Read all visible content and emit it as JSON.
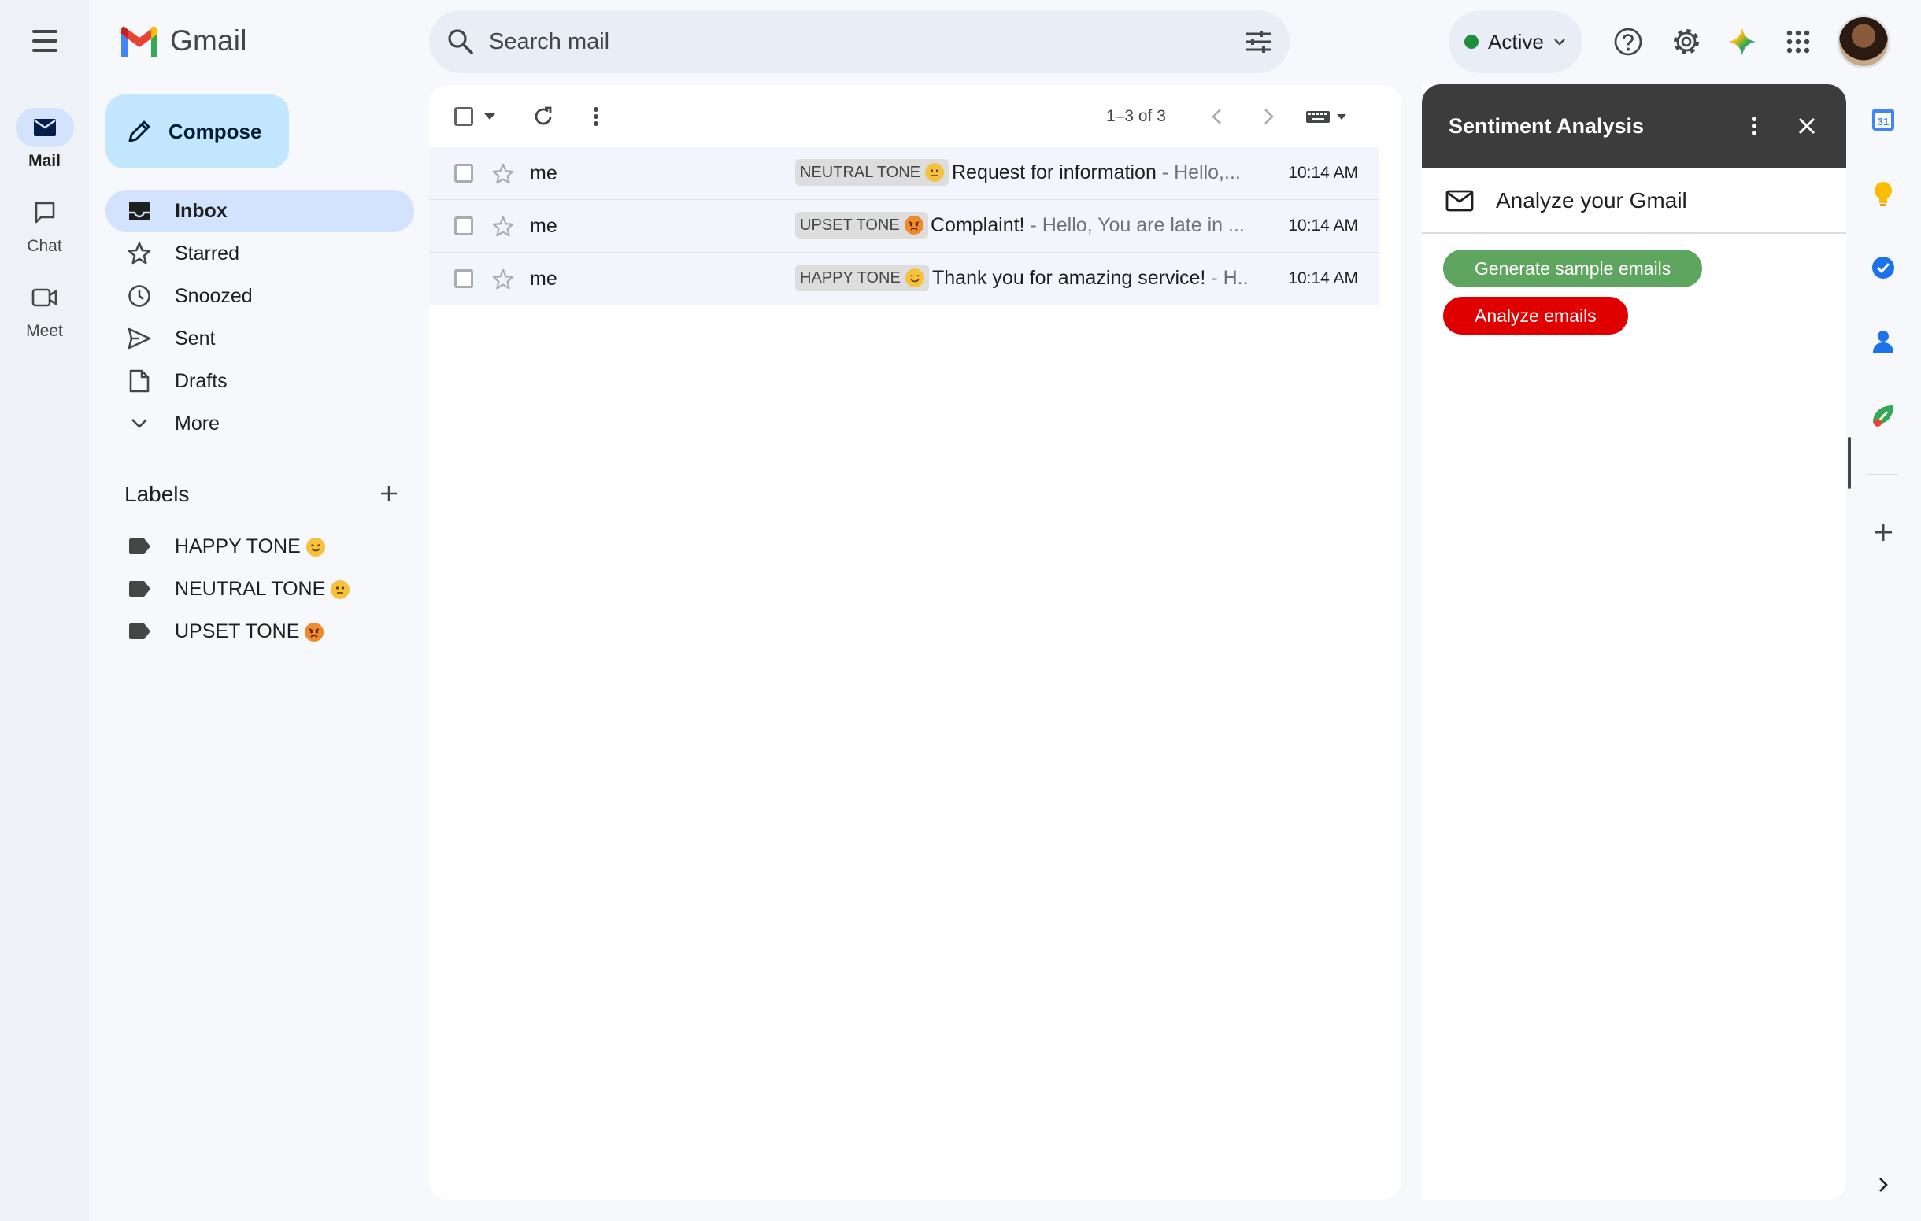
{
  "app": {
    "logo_text": "Gmail"
  },
  "rail": {
    "items": [
      {
        "label": "Mail",
        "icon": "mail-icon"
      },
      {
        "label": "Chat",
        "icon": "chat-icon"
      },
      {
        "label": "Meet",
        "icon": "video-icon"
      }
    ]
  },
  "search": {
    "placeholder": "Search mail"
  },
  "status": {
    "label": "Active",
    "color": "#1e8e3e"
  },
  "compose": {
    "label": "Compose"
  },
  "nav": {
    "items": [
      {
        "label": "Inbox",
        "icon": "inbox-icon"
      },
      {
        "label": "Starred",
        "icon": "star-icon"
      },
      {
        "label": "Snoozed",
        "icon": "clock-icon"
      },
      {
        "label": "Sent",
        "icon": "send-icon"
      },
      {
        "label": "Drafts",
        "icon": "draft-icon"
      },
      {
        "label": "More",
        "icon": "chevron-down-icon"
      }
    ]
  },
  "labels": {
    "title": "Labels",
    "items": [
      {
        "label": "HAPPY TONE",
        "emoji": "smiling-face"
      },
      {
        "label": "NEUTRAL TONE",
        "emoji": "neutral-face"
      },
      {
        "label": "UPSET TONE",
        "emoji": "angry-face"
      }
    ]
  },
  "toolbar": {
    "count": "1–3 of 3"
  },
  "emails": [
    {
      "sender": "me",
      "tag": "NEUTRAL TONE",
      "subject": "Request for information",
      "snippet": " - Hello,...",
      "time": "10:14 AM"
    },
    {
      "sender": "me",
      "tag": "UPSET TONE",
      "subject": "Complaint!",
      "snippet": " - Hello, You are late in ...",
      "time": "10:14 AM"
    },
    {
      "sender": "me",
      "tag": "HAPPY TONE",
      "subject": "Thank you for amazing service!",
      "snippet": " - H..",
      "time": "10:14 AM"
    }
  ],
  "panel": {
    "title": "Sentiment Analysis",
    "subtitle": "Analyze your Gmail",
    "generate_label": "Generate sample emails",
    "analyze_label": "Analyze emails",
    "generate_color": "#5ea55f",
    "analyze_color": "#e00000"
  },
  "side_apps": {
    "calendar_day": "31"
  },
  "colors": {
    "accent": "#0b57d0",
    "compose_bg": "#c2e7ff",
    "selected_nav": "#d3e3fd"
  }
}
